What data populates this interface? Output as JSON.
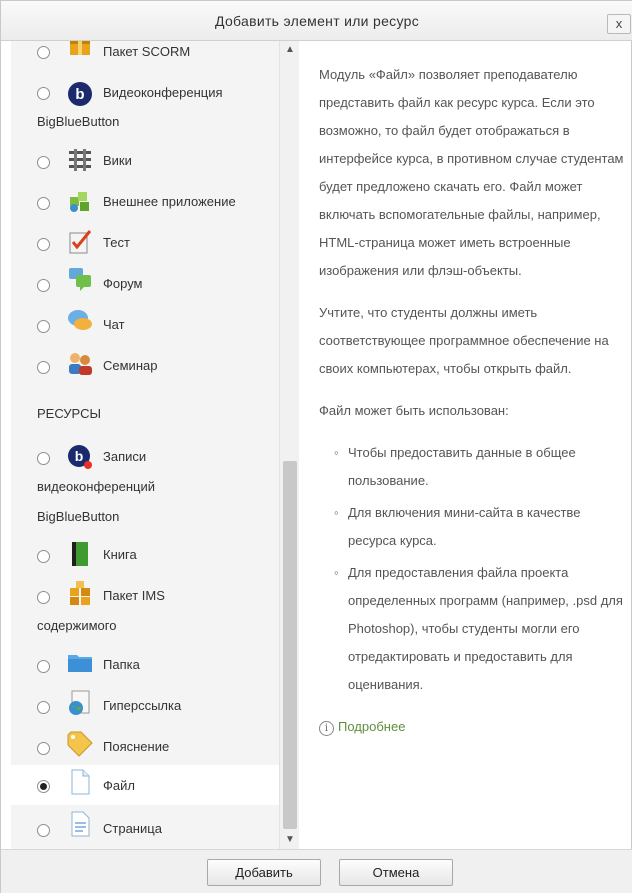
{
  "dialog": {
    "title": "Добавить элемент или ресурс",
    "close_label": "x"
  },
  "activities": [
    {
      "label": "Пакет SCORM",
      "icon": "scorm-package-icon",
      "selected": false
    },
    {
      "label": "Видеоконференция",
      "label2": "BigBlueButton",
      "icon": "bigbluebutton-icon",
      "selected": false
    },
    {
      "label": "Вики",
      "icon": "wiki-icon",
      "selected": false
    },
    {
      "label": "Внешнее приложение",
      "icon": "external-tool-icon",
      "selected": false
    },
    {
      "label": "Тест",
      "icon": "quiz-icon",
      "selected": false
    },
    {
      "label": "Форум",
      "icon": "forum-icon",
      "selected": false
    },
    {
      "label": "Чат",
      "icon": "chat-icon",
      "selected": false
    },
    {
      "label": "Семинар",
      "icon": "workshop-icon",
      "selected": false
    }
  ],
  "resources_heading": "РЕСУРСЫ",
  "resources": [
    {
      "label": "Записи",
      "label2": "видеоконференций",
      "label3": "BigBlueButton",
      "icon": "recordings-icon",
      "selected": false
    },
    {
      "label": "Книга",
      "icon": "book-icon",
      "selected": false
    },
    {
      "label": "Пакет IMS",
      "label2": "содержимого",
      "icon": "ims-package-icon",
      "selected": false
    },
    {
      "label": "Папка",
      "icon": "folder-icon",
      "selected": false
    },
    {
      "label": "Гиперссылка",
      "icon": "url-icon",
      "selected": false
    },
    {
      "label": "Пояснение",
      "icon": "label-icon",
      "selected": false
    },
    {
      "label": "Файл",
      "icon": "file-icon",
      "selected": true
    },
    {
      "label": "Страница",
      "icon": "page-icon",
      "selected": false
    }
  ],
  "description": {
    "para1": "Модуль «Файл» позволяет преподавателю представить файл как ресурс курса. Если это возможно, то файл будет отображаться в интерфейсе курса, в противном случае студентам будет предложено скачать его. Файл может включать вспомогательные файлы, например, HTML-страница может иметь встроенные изображения или флэш-объекты.",
    "para2": "Учтите, что студенты должны иметь соответствующее программное обеспечение на своих компьютерах, чтобы открыть файл.",
    "para3": "Файл может быть использован:",
    "bullets": [
      "Чтобы предоставить данные в общее пользование.",
      "Для включения мини-сайта в качестве ресурса курса.",
      "Для предоставления файла проекта определенных программ (например, .psd для Photoshop), чтобы студенты могли его отредактировать и предоставить для оценивания."
    ],
    "more_link": "Подробнее"
  },
  "footer": {
    "add_label": "Добавить",
    "cancel_label": "Отмена"
  }
}
